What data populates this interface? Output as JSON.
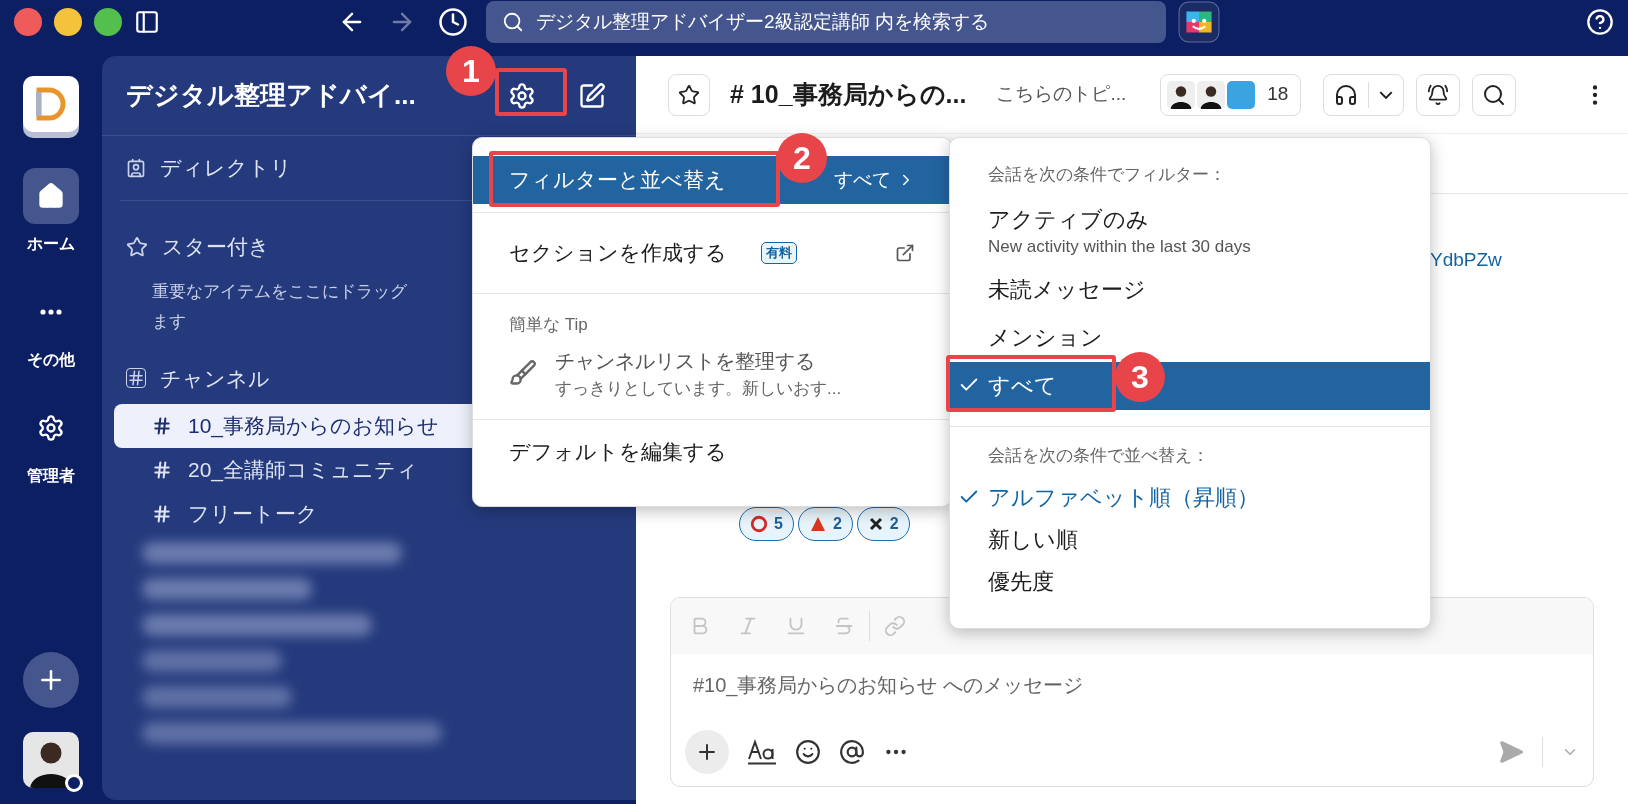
{
  "search": {
    "placeholder": "デジタル整理アドバイザー2級認定講師 内を検索する"
  },
  "rail": [
    {
      "label": "ホーム",
      "kind": "home",
      "selected": true
    },
    {
      "label": "その他",
      "kind": "more",
      "selected": false
    },
    {
      "label": "管理者",
      "kind": "admin",
      "selected": false
    }
  ],
  "sidebar": {
    "workspace_name": "デジタル整理アドバイ...",
    "directory": "ディレクトリ",
    "starred": {
      "title": "スター付き",
      "hint_lines": [
        "重要なアイテムをここにドラッグ",
        "ます"
      ]
    },
    "channels_title": "チャンネル",
    "channels": [
      {
        "name": "10_事務局からのお知らせ",
        "selected": true
      },
      {
        "name": "20_全講師コミュニティ",
        "selected": false
      },
      {
        "name": "フリートーク",
        "selected": false
      }
    ]
  },
  "channel_header": {
    "title": "# 10_事務局からの...",
    "topic": "こちらのトピ...",
    "member_count": "18"
  },
  "message": {
    "link": "YdbPZw",
    "reactions": [
      {
        "kind": "circle",
        "count": "5"
      },
      {
        "kind": "triangle",
        "count": "2"
      },
      {
        "kind": "cross",
        "count": "2"
      }
    ]
  },
  "composer": {
    "placeholder": "#10_事務局からのお知らせ へのメッセージ"
  },
  "menu": {
    "items": [
      {
        "kind": "submenu",
        "label": "フィルターと並べ替え",
        "value": "すべて",
        "selected": true
      },
      {
        "kind": "external",
        "label": "セクションを作成する",
        "badge": "有料",
        "selected": false
      },
      {
        "kind": "tip",
        "heading": "簡単な Tip",
        "title": "チャンネルリストを整理する",
        "text": "すっきりとしています。新しいおす..."
      },
      {
        "kind": "action",
        "label": "デフォルトを編集する",
        "selected": false
      }
    ]
  },
  "submenu": {
    "filter_heading": "会話を次の条件でフィルター：",
    "filters": [
      {
        "label": "アクティブのみ",
        "description": "New activity within the last 30 days",
        "checked": false,
        "selected": false
      },
      {
        "label": "未読メッセージ",
        "checked": false,
        "selected": false
      },
      {
        "label": "メンション",
        "checked": false,
        "selected": false
      },
      {
        "label": "すべて",
        "checked": true,
        "selected": true
      }
    ],
    "sort_heading": "会話を次の条件で並べ替え：",
    "sorts": [
      {
        "label": "アルファベット順（昇順）",
        "checked": true
      },
      {
        "label": "新しい順",
        "checked": false
      },
      {
        "label": "優先度",
        "checked": false
      }
    ]
  },
  "annotations": [
    {
      "number": "1"
    },
    {
      "number": "2"
    },
    {
      "number": "3"
    }
  ]
}
